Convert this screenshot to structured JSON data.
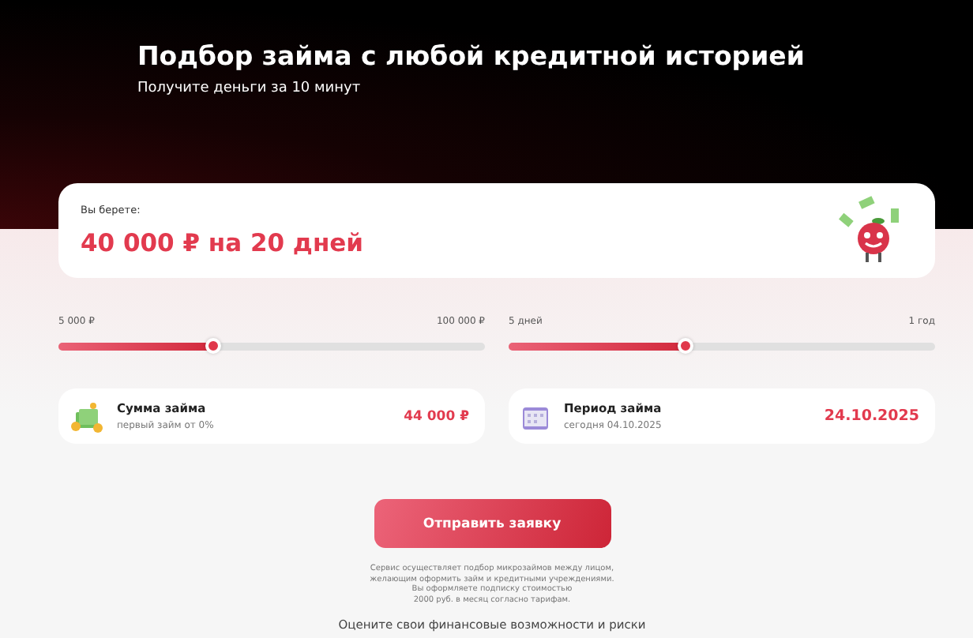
{
  "header": {
    "title": "Подбор займа с любой кредитной историей",
    "subtitle": "Получите деньги за 10 минут"
  },
  "summary": {
    "label": "Вы берете:",
    "amount": "40 000 ₽ на 20 дней"
  },
  "sliders": [
    {
      "min_label": "5 000 ₽",
      "max_label": "100 000 ₽",
      "level": 0.363
    },
    {
      "min_label": "5 дней",
      "max_label": "1 год",
      "level": 0.415
    }
  ],
  "info_cards": [
    {
      "kind": "money",
      "title": "Сумма займа",
      "note": "первый займ от 0%",
      "value": "44 000 ₽"
    },
    {
      "kind": "calendar",
      "title": "Период займа",
      "note": "сегодня 04.10.2025",
      "value": "24.10.2025"
    }
  ],
  "submit_button": "Отправить заявку",
  "disclaimer": [
    "Сервис осуществляет подбор микрозаймов между лицом,",
    "желающим оформить займ и кредитными учреждениями.",
    "Вы оформляете подписку стоимостью",
    "2000 руб. в месяц согласно тарифам."
  ],
  "footer_text": "Оцените свои финансовые возможности и риски"
}
